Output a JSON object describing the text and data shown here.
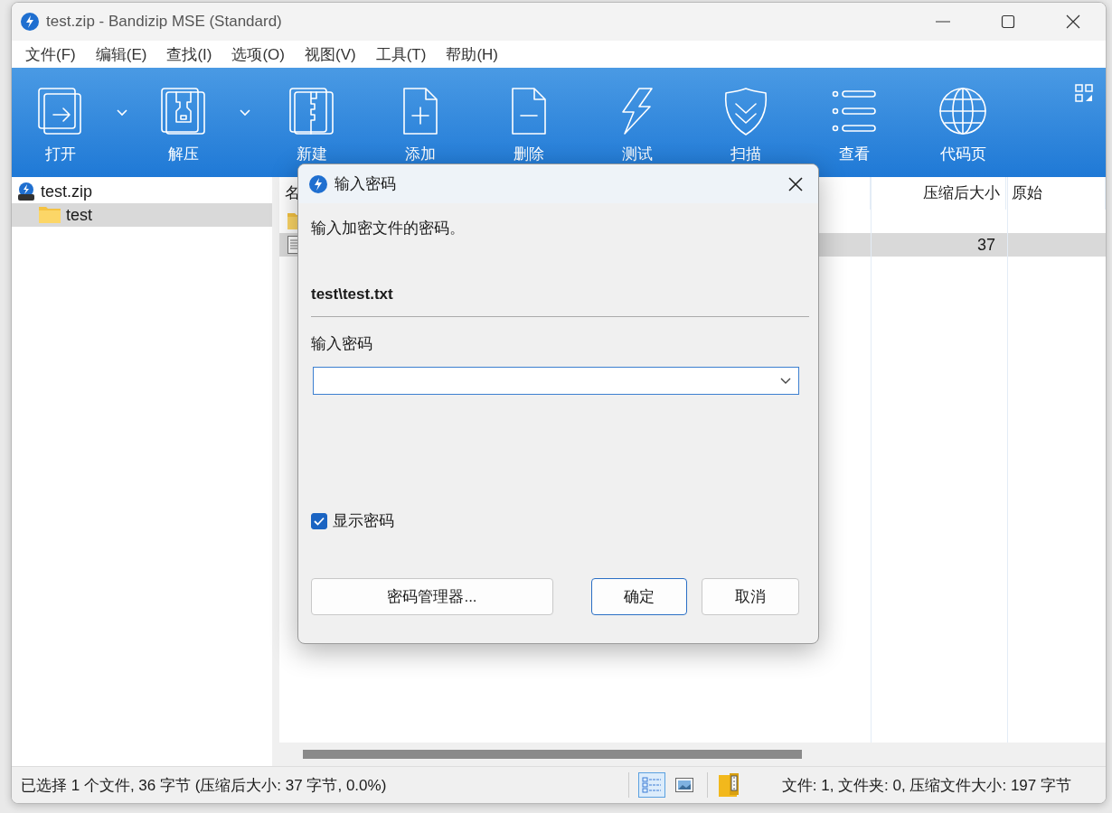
{
  "window": {
    "title": "test.zip - Bandizip MSE (Standard)"
  },
  "menu": [
    "文件(F)",
    "编辑(E)",
    "查找(I)",
    "选项(O)",
    "视图(V)",
    "工具(T)",
    "帮助(H)"
  ],
  "toolbar": [
    {
      "label": "打开",
      "kind": "open",
      "dropdown": true
    },
    {
      "label": "解压",
      "kind": "extract",
      "dropdown": true
    },
    {
      "label": "新建",
      "kind": "new",
      "dropdown": false
    },
    {
      "label": "添加",
      "kind": "add",
      "dropdown": false
    },
    {
      "label": "删除",
      "kind": "delete",
      "dropdown": false
    },
    {
      "label": "测试",
      "kind": "test",
      "dropdown": false
    },
    {
      "label": "扫描",
      "kind": "scan",
      "dropdown": false
    },
    {
      "label": "查看",
      "kind": "view",
      "dropdown": false
    },
    {
      "label": "代码页",
      "kind": "codepage",
      "dropdown": false
    }
  ],
  "tree": [
    {
      "label": "test.zip",
      "kind": "archive",
      "selected": false,
      "children": [
        {
          "label": "test",
          "kind": "folder",
          "selected": true
        }
      ]
    }
  ],
  "file_list": {
    "columns": [
      {
        "label": "名"
      },
      {
        "label": "压缩后大小"
      },
      {
        "label": "原始"
      }
    ],
    "rows": [
      {
        "kind": "folder",
        "selected": false
      },
      {
        "kind": "file",
        "selected": true,
        "compressed_size": "37"
      }
    ]
  },
  "dialog": {
    "title": "输入密码",
    "message": "输入加密文件的密码。",
    "file": "test\\test.txt",
    "field_label": "输入密码",
    "show_password": {
      "label": "显示密码",
      "checked": true
    },
    "buttons": [
      {
        "label": "密码管理器...",
        "kind": "manager",
        "default": false
      },
      {
        "label": "确定",
        "kind": "ok",
        "default": true
      },
      {
        "label": "取消",
        "kind": "cancel",
        "default": false
      }
    ]
  },
  "status_bar": {
    "left": "已选择 1 个文件, 36 字节 (压缩后大小: 37 字节, 0.0%)",
    "view_modes": [
      {
        "kind": "list",
        "selected": true
      },
      {
        "kind": "thumbnail",
        "selected": false
      }
    ],
    "right": "文件: 1, 文件夹: 0, 压缩文件大小: 197 字节"
  }
}
